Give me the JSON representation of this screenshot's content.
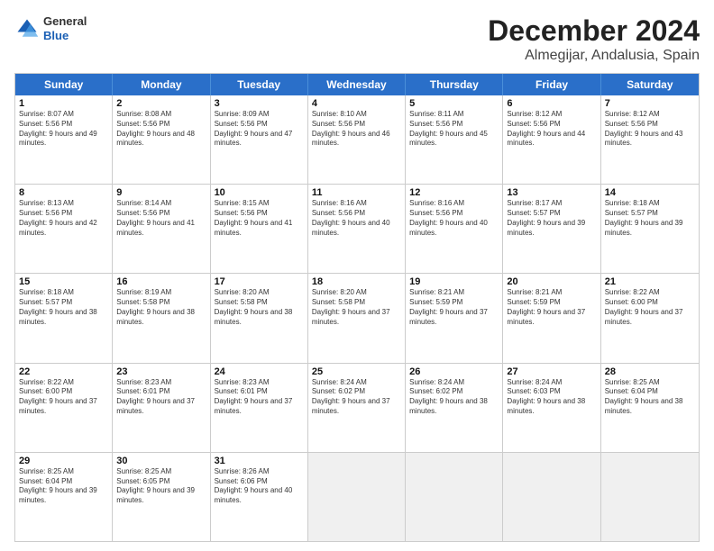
{
  "logo": {
    "general": "General",
    "blue": "Blue"
  },
  "title": "December 2024",
  "subtitle": "Almegijar, Andalusia, Spain",
  "header_days": [
    "Sunday",
    "Monday",
    "Tuesday",
    "Wednesday",
    "Thursday",
    "Friday",
    "Saturday"
  ],
  "weeks": [
    [
      {
        "day": "1",
        "sunrise": "Sunrise: 8:07 AM",
        "sunset": "Sunset: 5:56 PM",
        "daylight": "Daylight: 9 hours and 49 minutes."
      },
      {
        "day": "2",
        "sunrise": "Sunrise: 8:08 AM",
        "sunset": "Sunset: 5:56 PM",
        "daylight": "Daylight: 9 hours and 48 minutes."
      },
      {
        "day": "3",
        "sunrise": "Sunrise: 8:09 AM",
        "sunset": "Sunset: 5:56 PM",
        "daylight": "Daylight: 9 hours and 47 minutes."
      },
      {
        "day": "4",
        "sunrise": "Sunrise: 8:10 AM",
        "sunset": "Sunset: 5:56 PM",
        "daylight": "Daylight: 9 hours and 46 minutes."
      },
      {
        "day": "5",
        "sunrise": "Sunrise: 8:11 AM",
        "sunset": "Sunset: 5:56 PM",
        "daylight": "Daylight: 9 hours and 45 minutes."
      },
      {
        "day": "6",
        "sunrise": "Sunrise: 8:12 AM",
        "sunset": "Sunset: 5:56 PM",
        "daylight": "Daylight: 9 hours and 44 minutes."
      },
      {
        "day": "7",
        "sunrise": "Sunrise: 8:12 AM",
        "sunset": "Sunset: 5:56 PM",
        "daylight": "Daylight: 9 hours and 43 minutes."
      }
    ],
    [
      {
        "day": "8",
        "sunrise": "Sunrise: 8:13 AM",
        "sunset": "Sunset: 5:56 PM",
        "daylight": "Daylight: 9 hours and 42 minutes."
      },
      {
        "day": "9",
        "sunrise": "Sunrise: 8:14 AM",
        "sunset": "Sunset: 5:56 PM",
        "daylight": "Daylight: 9 hours and 41 minutes."
      },
      {
        "day": "10",
        "sunrise": "Sunrise: 8:15 AM",
        "sunset": "Sunset: 5:56 PM",
        "daylight": "Daylight: 9 hours and 41 minutes."
      },
      {
        "day": "11",
        "sunrise": "Sunrise: 8:16 AM",
        "sunset": "Sunset: 5:56 PM",
        "daylight": "Daylight: 9 hours and 40 minutes."
      },
      {
        "day": "12",
        "sunrise": "Sunrise: 8:16 AM",
        "sunset": "Sunset: 5:56 PM",
        "daylight": "Daylight: 9 hours and 40 minutes."
      },
      {
        "day": "13",
        "sunrise": "Sunrise: 8:17 AM",
        "sunset": "Sunset: 5:57 PM",
        "daylight": "Daylight: 9 hours and 39 minutes."
      },
      {
        "day": "14",
        "sunrise": "Sunrise: 8:18 AM",
        "sunset": "Sunset: 5:57 PM",
        "daylight": "Daylight: 9 hours and 39 minutes."
      }
    ],
    [
      {
        "day": "15",
        "sunrise": "Sunrise: 8:18 AM",
        "sunset": "Sunset: 5:57 PM",
        "daylight": "Daylight: 9 hours and 38 minutes."
      },
      {
        "day": "16",
        "sunrise": "Sunrise: 8:19 AM",
        "sunset": "Sunset: 5:58 PM",
        "daylight": "Daylight: 9 hours and 38 minutes."
      },
      {
        "day": "17",
        "sunrise": "Sunrise: 8:20 AM",
        "sunset": "Sunset: 5:58 PM",
        "daylight": "Daylight: 9 hours and 38 minutes."
      },
      {
        "day": "18",
        "sunrise": "Sunrise: 8:20 AM",
        "sunset": "Sunset: 5:58 PM",
        "daylight": "Daylight: 9 hours and 37 minutes."
      },
      {
        "day": "19",
        "sunrise": "Sunrise: 8:21 AM",
        "sunset": "Sunset: 5:59 PM",
        "daylight": "Daylight: 9 hours and 37 minutes."
      },
      {
        "day": "20",
        "sunrise": "Sunrise: 8:21 AM",
        "sunset": "Sunset: 5:59 PM",
        "daylight": "Daylight: 9 hours and 37 minutes."
      },
      {
        "day": "21",
        "sunrise": "Sunrise: 8:22 AM",
        "sunset": "Sunset: 6:00 PM",
        "daylight": "Daylight: 9 hours and 37 minutes."
      }
    ],
    [
      {
        "day": "22",
        "sunrise": "Sunrise: 8:22 AM",
        "sunset": "Sunset: 6:00 PM",
        "daylight": "Daylight: 9 hours and 37 minutes."
      },
      {
        "day": "23",
        "sunrise": "Sunrise: 8:23 AM",
        "sunset": "Sunset: 6:01 PM",
        "daylight": "Daylight: 9 hours and 37 minutes."
      },
      {
        "day": "24",
        "sunrise": "Sunrise: 8:23 AM",
        "sunset": "Sunset: 6:01 PM",
        "daylight": "Daylight: 9 hours and 37 minutes."
      },
      {
        "day": "25",
        "sunrise": "Sunrise: 8:24 AM",
        "sunset": "Sunset: 6:02 PM",
        "daylight": "Daylight: 9 hours and 37 minutes."
      },
      {
        "day": "26",
        "sunrise": "Sunrise: 8:24 AM",
        "sunset": "Sunset: 6:02 PM",
        "daylight": "Daylight: 9 hours and 38 minutes."
      },
      {
        "day": "27",
        "sunrise": "Sunrise: 8:24 AM",
        "sunset": "Sunset: 6:03 PM",
        "daylight": "Daylight: 9 hours and 38 minutes."
      },
      {
        "day": "28",
        "sunrise": "Sunrise: 8:25 AM",
        "sunset": "Sunset: 6:04 PM",
        "daylight": "Daylight: 9 hours and 38 minutes."
      }
    ],
    [
      {
        "day": "29",
        "sunrise": "Sunrise: 8:25 AM",
        "sunset": "Sunset: 6:04 PM",
        "daylight": "Daylight: 9 hours and 39 minutes."
      },
      {
        "day": "30",
        "sunrise": "Sunrise: 8:25 AM",
        "sunset": "Sunset: 6:05 PM",
        "daylight": "Daylight: 9 hours and 39 minutes."
      },
      {
        "day": "31",
        "sunrise": "Sunrise: 8:26 AM",
        "sunset": "Sunset: 6:06 PM",
        "daylight": "Daylight: 9 hours and 40 minutes."
      },
      null,
      null,
      null,
      null
    ]
  ]
}
